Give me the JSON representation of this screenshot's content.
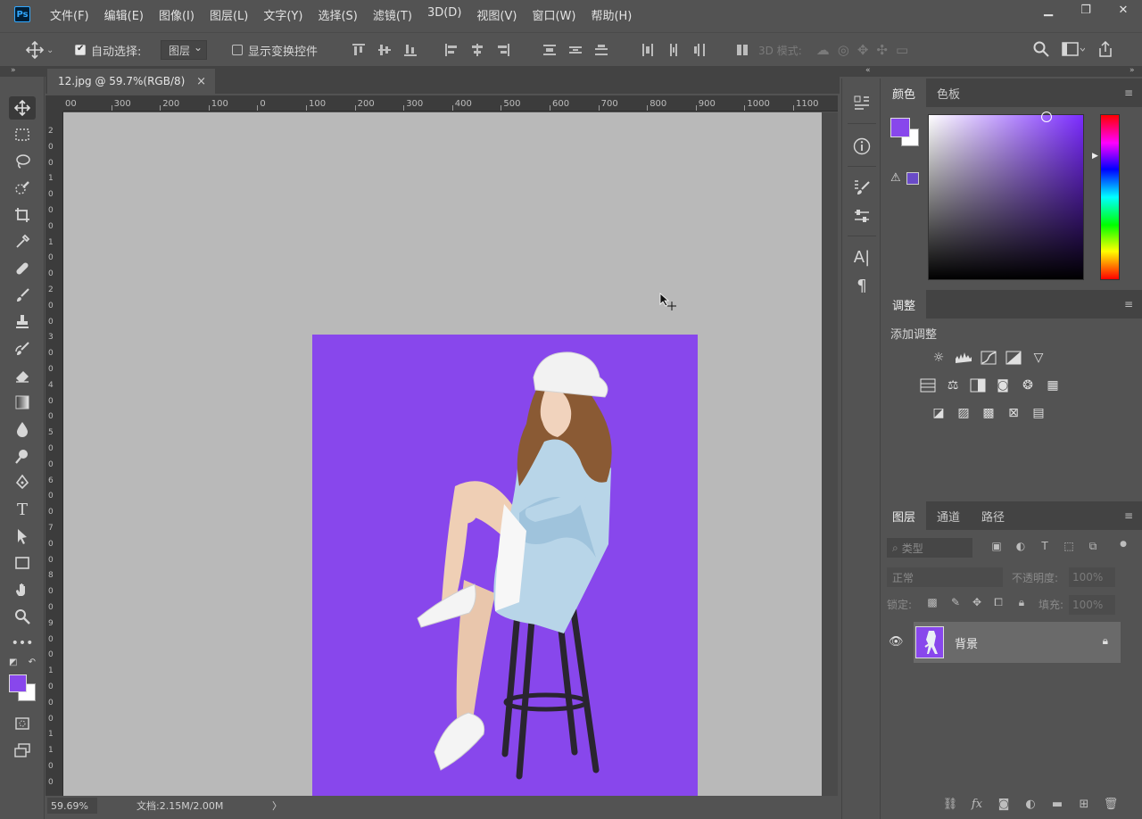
{
  "app": {
    "logo_text": "Ps"
  },
  "menu": [
    "文件(F)",
    "编辑(E)",
    "图像(I)",
    "图层(L)",
    "文字(Y)",
    "选择(S)",
    "滤镜(T)",
    "3D(D)",
    "视图(V)",
    "窗口(W)",
    "帮助(H)"
  ],
  "window_controls": {
    "minimize": "▁",
    "restore": "❐",
    "close": "✕"
  },
  "options": {
    "auto_select_label": "自动选择:",
    "auto_select_checked": true,
    "auto_select_target": "图层",
    "show_transform_label": "显示变换控件",
    "show_transform_checked": false,
    "mode_3d_label": "3D 模式:"
  },
  "document": {
    "tab_title": "12.jpg @ 59.7%(RGB/8)",
    "tab_close": "×",
    "image_bg_color": "#8847ec",
    "ruler_top": [
      "00",
      "300",
      "200",
      "100",
      "0",
      "100",
      "200",
      "300",
      "400",
      "500",
      "600",
      "700",
      "800",
      "900",
      "1000",
      "1100"
    ],
    "ruler_left": [
      "2",
      "0",
      "0",
      "1",
      "0",
      "0",
      "0",
      "1",
      "0",
      "0",
      "2",
      "0",
      "0",
      "3",
      "0",
      "0",
      "4",
      "0",
      "0",
      "5",
      "0",
      "0",
      "6",
      "0",
      "0",
      "7",
      "0",
      "0",
      "8",
      "0",
      "0",
      "9",
      "0",
      "0",
      "1",
      "0",
      "0",
      "0",
      "1",
      "1",
      "0",
      "0"
    ]
  },
  "status": {
    "zoom": "59.69%",
    "doc_info": "文档:2.15M/2.00M",
    "arrow": "〉"
  },
  "color_panel": {
    "tabs": [
      "颜色",
      "色板"
    ],
    "active_tab": 0,
    "foreground": "#8847ec",
    "background": "#ffffff",
    "gamut_warning_color": "#6a4bc8"
  },
  "adjustments_panel": {
    "tab": "调整",
    "title": "添加调整",
    "row1": [
      "brightness-contrast-icon",
      "levels-icon",
      "curves-icon",
      "exposure-icon",
      "vibrance-icon"
    ],
    "row2": [
      "hue-saturation-icon",
      "color-balance-icon",
      "black-white-icon",
      "photo-filter-icon",
      "channel-mixer-icon",
      "color-lookup-icon"
    ],
    "row3": [
      "invert-icon",
      "posterize-icon",
      "threshold-icon",
      "selective-color-icon",
      "gradient-map-icon"
    ]
  },
  "layers_panel": {
    "tabs": [
      "图层",
      "通道",
      "路径"
    ],
    "active_tab": 0,
    "filter_placeholder": "类型",
    "blend_mode": "正常",
    "opacity_label": "不透明度:",
    "opacity_value": "100%",
    "lock_label": "锁定:",
    "fill_label": "填充:",
    "fill_value": "100%",
    "layers": [
      {
        "name": "背景",
        "visible": true,
        "locked": true
      }
    ]
  },
  "panel_menu_glyph": "≡"
}
